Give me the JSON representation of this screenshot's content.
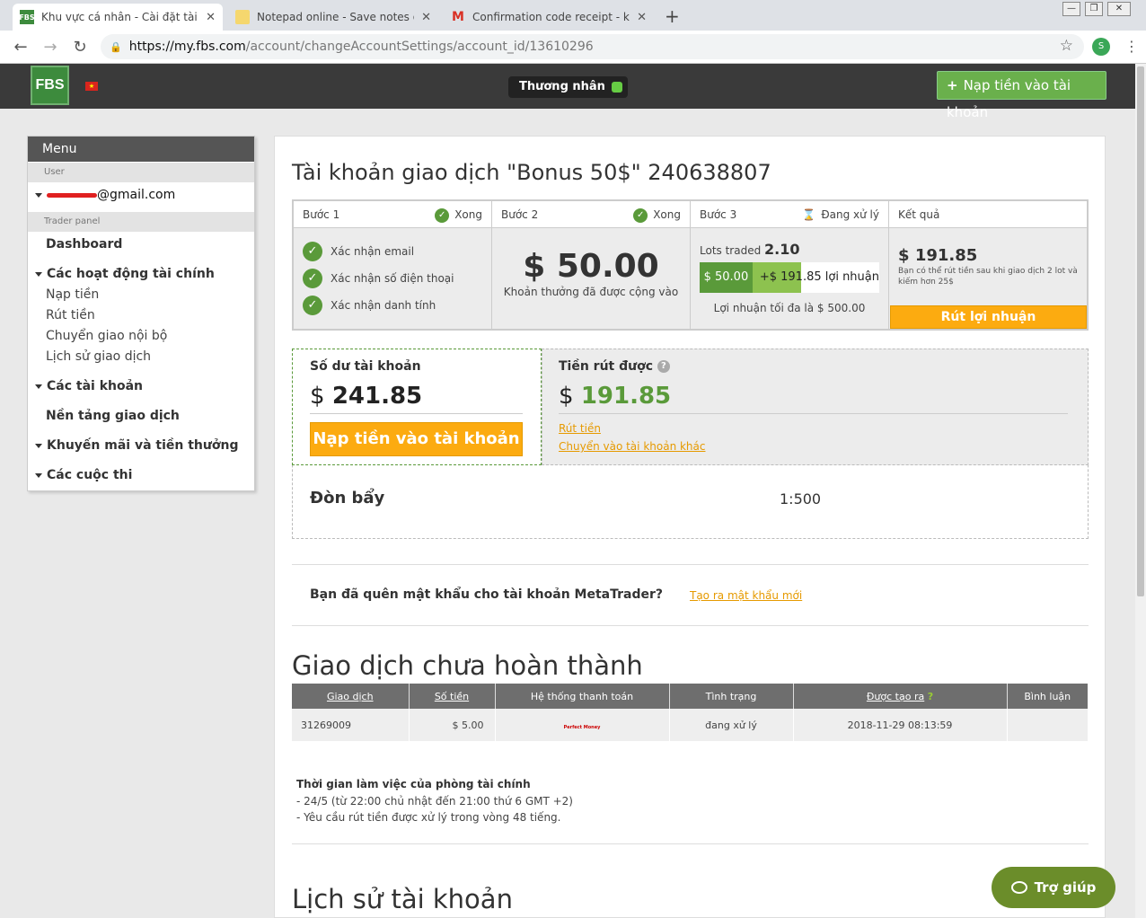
{
  "browser": {
    "tabs": [
      {
        "title": "Khu vực cá nhân - Cài đặt tài khoản",
        "favicon": "FBS",
        "active": true
      },
      {
        "title": "Notepad online - Save notes online",
        "favicon": "notepad",
        "active": false
      },
      {
        "title": "Confirmation code receipt - kissthief",
        "favicon": "M",
        "active": false
      }
    ],
    "url_host": "https://my.fbs.com",
    "url_path": "/account/changeAccountSettings/account_id/13610296",
    "profile_initial": "S"
  },
  "header": {
    "logo": "FBS",
    "role": "Thương nhân",
    "deposit_button": "Nạp tiền vào tài khoản"
  },
  "sidebar": {
    "title": "Menu",
    "user_section": "User",
    "email": "@gmail.com",
    "trader_section": "Trader panel",
    "dashboard": "Dashboard",
    "finance_group": "Các hoạt động tài chính",
    "finance_items": [
      "Nạp tiền",
      "Rút tiền",
      "Chuyển giao nội bộ",
      "Lịch sử giao dịch"
    ],
    "accounts": "Các tài khoản",
    "platforms": "Nền tảng giao dịch",
    "promos": "Khuyến mãi và tiền thưởng",
    "contests": "Các cuộc thi"
  },
  "account": {
    "title": "Tài khoản giao dịch \"Bonus 50$\" 240638807",
    "step1": {
      "label": "Bước 1",
      "status": "Xong",
      "items": [
        "Xác nhận email",
        "Xác nhận số điện thoại",
        "Xác nhận danh tính"
      ]
    },
    "step2": {
      "label": "Bước 2",
      "status": "Xong",
      "amount": "$ 50.00",
      "caption": "Khoản thưởng đã được cộng vào"
    },
    "step3": {
      "label": "Bước 3",
      "status": "Đang xử lý",
      "lots_label": "Lots traded",
      "lots_value": "2.10",
      "bar_bonus": "$ 50.00",
      "bar_profit": "+$ 191.85 lợi nhuận",
      "max_profit": "Lợi nhuận tối đa là $ 500.00"
    },
    "result": {
      "label": "Kết quả",
      "amount": "191.85",
      "currency": "$",
      "note": "Bạn có thể rút tiền sau khi giao dịch 2 lot và kiếm hơn 25$",
      "button": "Rút lợi nhuận"
    }
  },
  "balance": {
    "label": "Số dư tài khoản",
    "currency": "$",
    "value": "241.85",
    "deposit_button": "Nạp tiền vào tài khoản",
    "withdrawable_label": "Tiền rút được",
    "withdrawable_value": "191.85",
    "withdraw_link": "Rút tiền",
    "transfer_link": "Chuyển vào tài khoản khác",
    "leverage_label": "Đòn bẩy",
    "leverage_value": "1:500"
  },
  "password": {
    "question": "Bạn đã quên mật khẩu cho tài khoản MetaTrader?",
    "link": "Tạo ra mật khẩu mới"
  },
  "pending": {
    "title": "Giao dịch chưa hoàn thành",
    "columns": [
      "Giao dịch",
      "Số tiền",
      "Hệ thống thanh toán",
      "Tình trạng",
      "Được tạo ra",
      "Bình luận"
    ],
    "rows": [
      {
        "id": "31269009",
        "amount": "$ 5.00",
        "system": "Perfect Money",
        "status": "đang xử lý",
        "created": "2018-11-29 08:13:59",
        "comment": ""
      }
    ]
  },
  "hours": {
    "title": "Thời gian làm việc của phòng tài chính",
    "line1": "- 24/5 (từ 22:00 chủ nhật đến 21:00 thứ 6 GMT +2)",
    "line2": "- Yêu cầu rút tiền được xử lý trong vòng 48 tiếng."
  },
  "history": {
    "title": "Lịch sử tài khoản"
  },
  "help": {
    "label": "Trợ giúp"
  }
}
